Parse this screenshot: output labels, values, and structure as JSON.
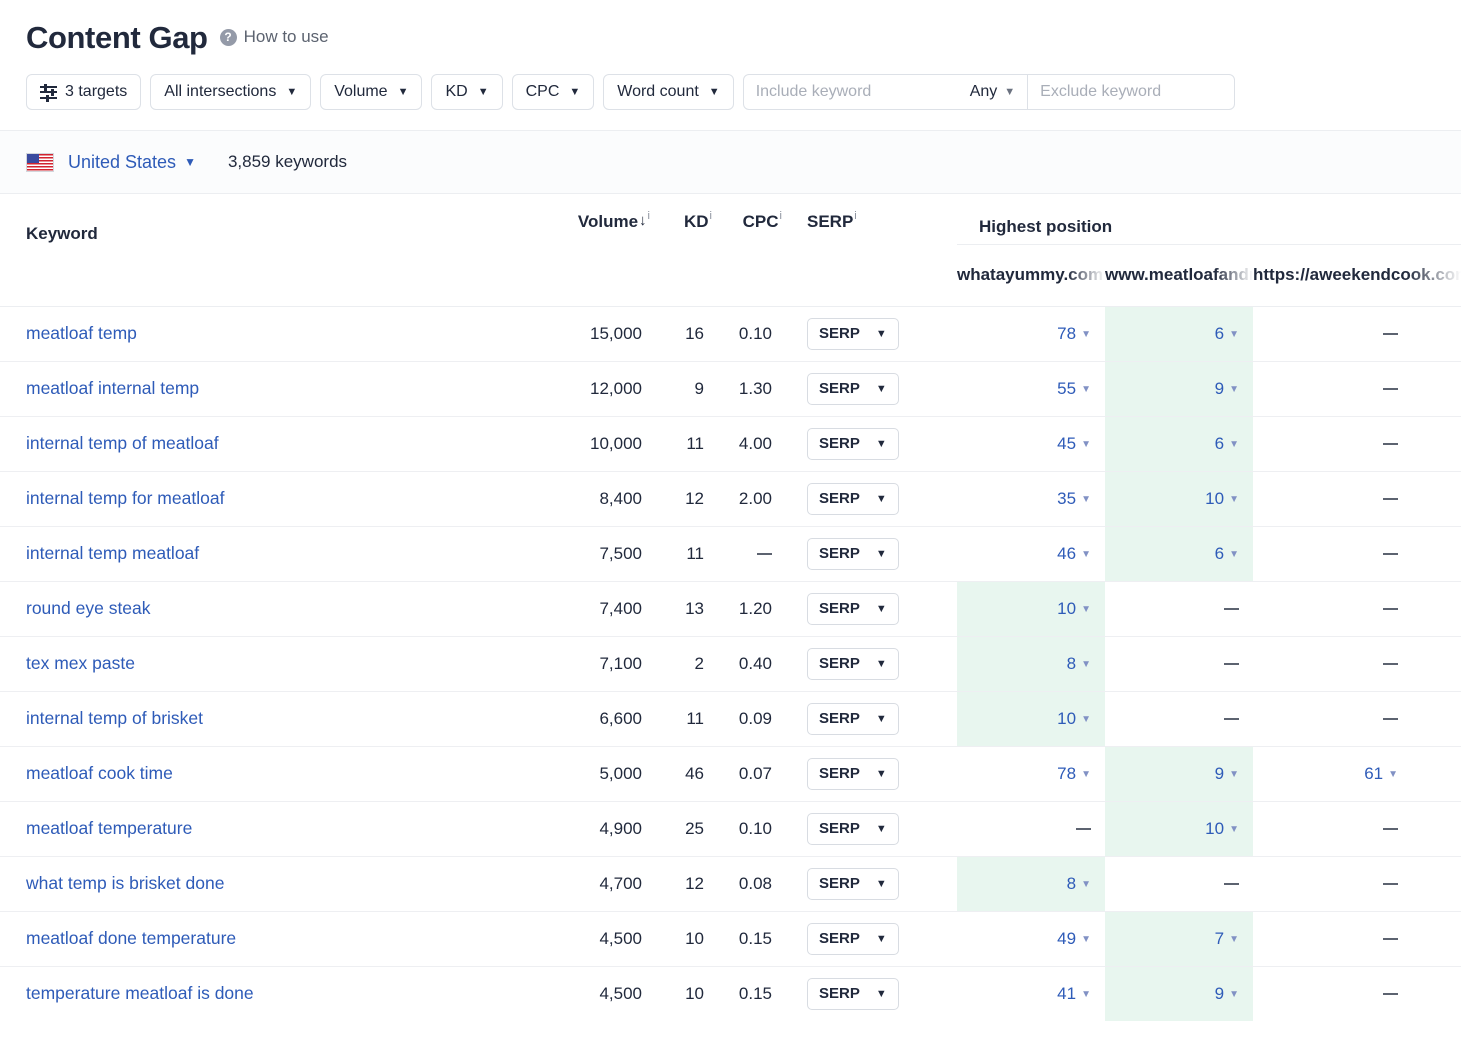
{
  "header": {
    "title": "Content Gap",
    "help_icon": "question-mark-circle-icon",
    "how_to_use": "How to use"
  },
  "filters": {
    "targets": "3 targets",
    "targets_icon": "sliders-icon",
    "intersections": "All intersections",
    "volume": "Volume",
    "kd": "KD",
    "cpc": "CPC",
    "word_count": "Word count",
    "include_placeholder": "Include keyword",
    "any": "Any",
    "exclude_placeholder": "Exclude keyword",
    "caret": "▼"
  },
  "country_bar": {
    "flag_icon": "us-flag-icon",
    "country": "United States",
    "caret": "▼",
    "keywords_count": "3,859 keywords"
  },
  "table": {
    "headers": {
      "keyword": "Keyword",
      "volume": "Volume",
      "volume_sort": "↓",
      "kd": "KD",
      "cpc": "CPC",
      "serp": "SERP",
      "info": "i",
      "highest_position": "Highest position"
    },
    "targets": [
      "whatayummy.com",
      "www.meatloafandmelodrama.com",
      "https://aweekendcook.com"
    ],
    "serp_button": "SERP",
    "dash": "—",
    "caret": "▼"
  },
  "rows": [
    {
      "keyword": "meatloaf temp",
      "volume": "15,000",
      "kd": "16",
      "cpc": "0.10",
      "serp": "SERP",
      "positions": [
        "78",
        "6",
        "—"
      ],
      "highlight": 1
    },
    {
      "keyword": "meatloaf internal temp",
      "volume": "12,000",
      "kd": "9",
      "cpc": "1.30",
      "serp": "SERP",
      "positions": [
        "55",
        "9",
        "—"
      ],
      "highlight": 1
    },
    {
      "keyword": "internal temp of meatloaf",
      "volume": "10,000",
      "kd": "11",
      "cpc": "4.00",
      "serp": "SERP",
      "positions": [
        "45",
        "6",
        "—"
      ],
      "highlight": 1
    },
    {
      "keyword": "internal temp for meatloaf",
      "volume": "8,400",
      "kd": "12",
      "cpc": "2.00",
      "serp": "SERP",
      "positions": [
        "35",
        "10",
        "—"
      ],
      "highlight": 1
    },
    {
      "keyword": "internal temp meatloaf",
      "volume": "7,500",
      "kd": "11",
      "cpc": "—",
      "serp": "SERP",
      "positions": [
        "46",
        "6",
        "—"
      ],
      "highlight": 1
    },
    {
      "keyword": "round eye steak",
      "volume": "7,400",
      "kd": "13",
      "cpc": "1.20",
      "serp": "SERP",
      "positions": [
        "10",
        "—",
        "—"
      ],
      "highlight": 0
    },
    {
      "keyword": "tex mex paste",
      "volume": "7,100",
      "kd": "2",
      "cpc": "0.40",
      "serp": "SERP",
      "positions": [
        "8",
        "—",
        "—"
      ],
      "highlight": 0
    },
    {
      "keyword": "internal temp of brisket",
      "volume": "6,600",
      "kd": "11",
      "cpc": "0.09",
      "serp": "SERP",
      "positions": [
        "10",
        "—",
        "—"
      ],
      "highlight": 0
    },
    {
      "keyword": "meatloaf cook time",
      "volume": "5,000",
      "kd": "46",
      "cpc": "0.07",
      "serp": "SERP",
      "positions": [
        "78",
        "9",
        "61"
      ],
      "highlight": 1
    },
    {
      "keyword": "meatloaf temperature",
      "volume": "4,900",
      "kd": "25",
      "cpc": "0.10",
      "serp": "SERP",
      "positions": [
        "—",
        "10",
        "—"
      ],
      "highlight": 1
    },
    {
      "keyword": "what temp is brisket done",
      "volume": "4,700",
      "kd": "12",
      "cpc": "0.08",
      "serp": "SERP",
      "positions": [
        "8",
        "—",
        "—"
      ],
      "highlight": 0
    },
    {
      "keyword": "meatloaf done temperature",
      "volume": "4,500",
      "kd": "10",
      "cpc": "0.15",
      "serp": "SERP",
      "positions": [
        "49",
        "7",
        "—"
      ],
      "highlight": 1
    },
    {
      "keyword": "temperature meatloaf is done",
      "volume": "4,500",
      "kd": "10",
      "cpc": "0.15",
      "serp": "SERP",
      "positions": [
        "41",
        "9",
        "—"
      ],
      "highlight": 1
    }
  ]
}
